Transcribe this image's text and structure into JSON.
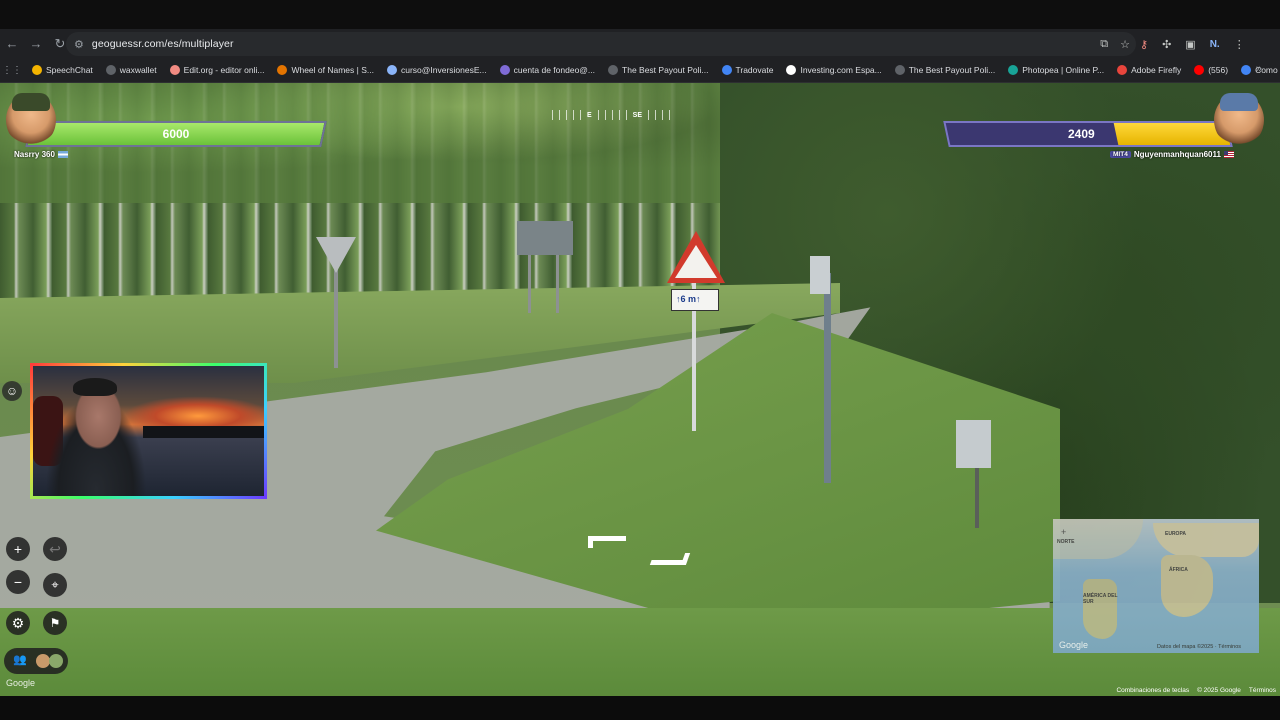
{
  "browser": {
    "url": "geoguessr.com/es/multiplayer",
    "bookmarks": [
      {
        "label": "SpeechChat",
        "color": "#f4b400"
      },
      {
        "label": "waxwallet",
        "color": "#5f6368"
      },
      {
        "label": "Edit.org - editor onli...",
        "color": "#f28b82"
      },
      {
        "label": "Wheel of Names | S...",
        "color": "#e37400"
      },
      {
        "label": "curso@InversionesE...",
        "color": "#8ab4f8"
      },
      {
        "label": "cuenta de fondeo@...",
        "color": "#7f6bd6"
      },
      {
        "label": "The Best Payout Poli...",
        "color": "#5f6368"
      },
      {
        "label": "Tradovate",
        "color": "#4285f4"
      },
      {
        "label": "Investing.com Espa...",
        "color": "#ffffff"
      },
      {
        "label": "The Best Payout Poli...",
        "color": "#5f6368"
      },
      {
        "label": "Photopea | Online P...",
        "color": "#18a497"
      },
      {
        "label": "Adobe Firefly",
        "color": "#e8453c"
      },
      {
        "label": "(556)",
        "color": "#ff0000"
      },
      {
        "label": "Como usar...",
        "color": "#4285f4"
      }
    ],
    "profile_initial": "N."
  },
  "compass": {
    "labels": [
      "E",
      "SE"
    ]
  },
  "player_left": {
    "name": "Nasrry 360",
    "health": "6000",
    "health_fraction": 1.0
  },
  "player_right": {
    "name": "Nguyenmanhquan6011",
    "tag": "MIT4",
    "health": "2409",
    "health_fraction": 0.4
  },
  "scene": {
    "sign_plate_text": "↑6 m↑"
  },
  "controls": {
    "zoom_in": "+",
    "zoom_out": "−",
    "undo": "↩",
    "pin": "⌖",
    "settings": "⚙",
    "flag": "⚑",
    "players": "👥",
    "emote": "☺",
    "google": "Google"
  },
  "minimap": {
    "labels": [
      "NORTE",
      "EUROPA",
      "ÁFRICA",
      "AMÉRICA DEL SUR"
    ],
    "google": "Google",
    "attribution": "Datos del mapa ©2025 · Términos"
  },
  "footer": {
    "shortcuts": "Combinaciones de teclas",
    "copyright": "© 2025 Google",
    "terms": "Términos"
  }
}
